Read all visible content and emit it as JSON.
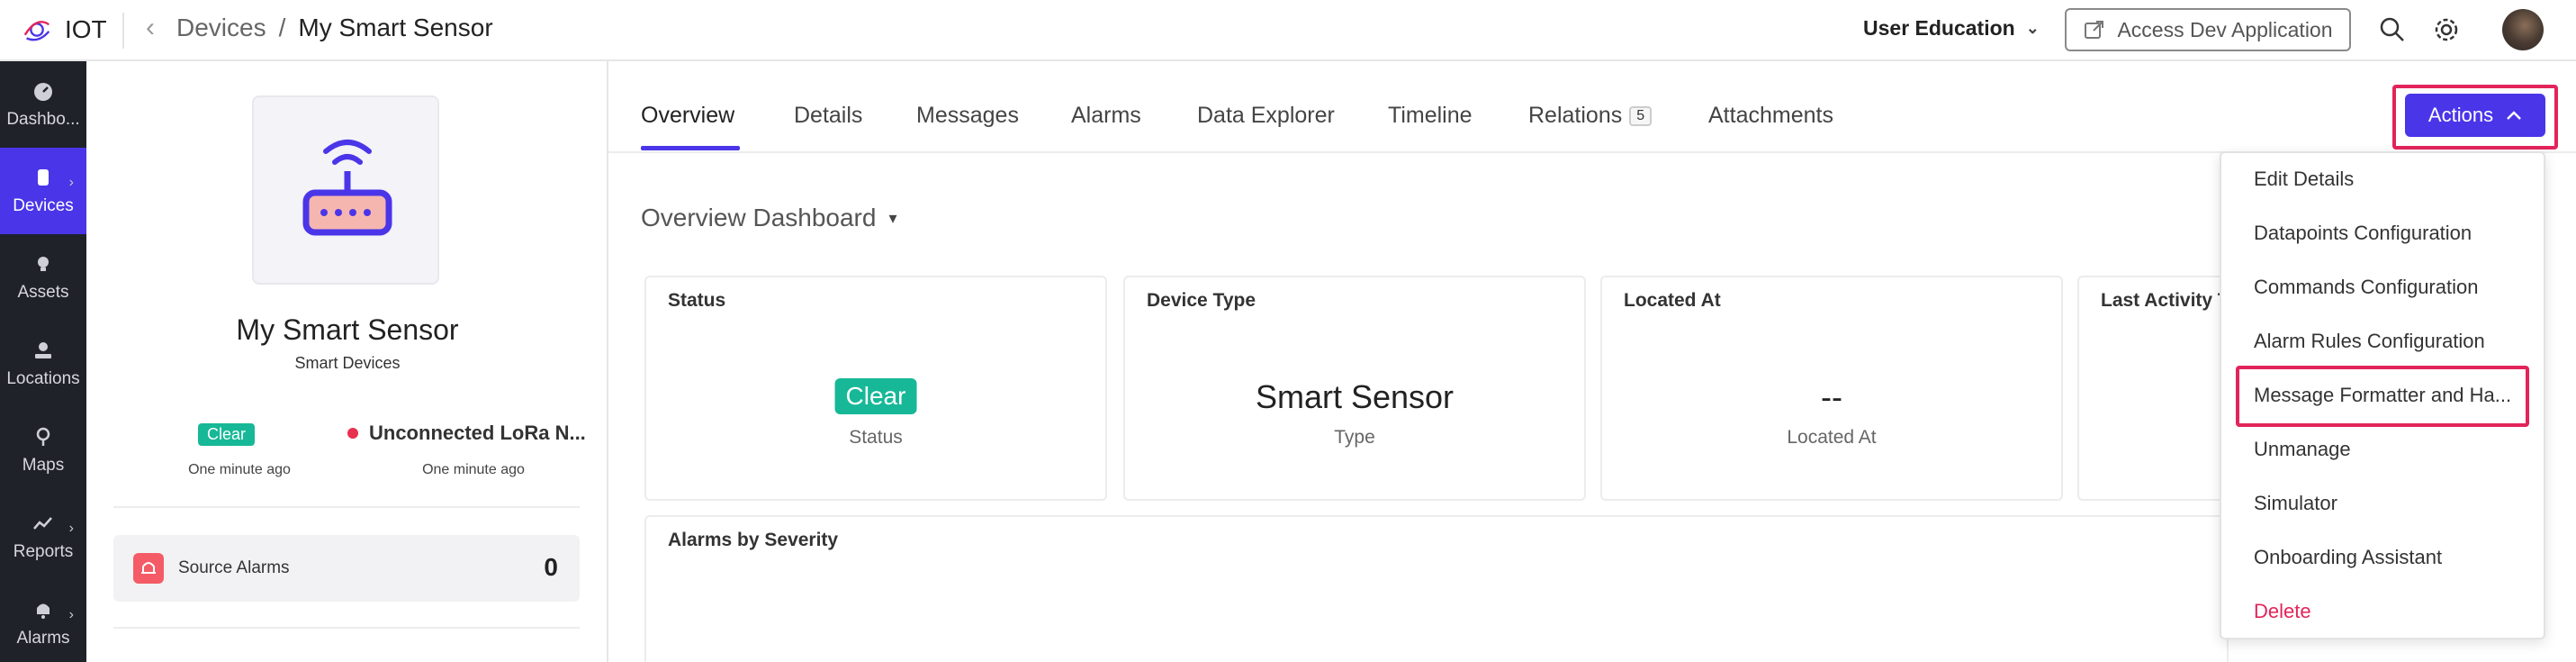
{
  "app": {
    "brand": "IOT"
  },
  "breadcrumb": {
    "parent": "Devices",
    "separator": "/",
    "current": "My Smart Sensor"
  },
  "header": {
    "org_name": "User Education",
    "dev_app_label": "Access Dev Application"
  },
  "nav": {
    "items": [
      {
        "label": "Dashbo..."
      },
      {
        "label": "Devices"
      },
      {
        "label": "Assets"
      },
      {
        "label": "Locations"
      },
      {
        "label": "Maps"
      },
      {
        "label": "Reports"
      },
      {
        "label": "Alarms"
      }
    ]
  },
  "device": {
    "name": "My Smart Sensor",
    "type": "Smart Devices",
    "status_badge": "Clear",
    "status_time": "One minute ago",
    "connection": "Unconnected LoRa N...",
    "connection_time": "One minute ago",
    "source_alarms_label": "Source Alarms",
    "source_alarms_count": "0"
  },
  "tabs": [
    {
      "label": "Overview"
    },
    {
      "label": "Details"
    },
    {
      "label": "Messages"
    },
    {
      "label": "Alarms"
    },
    {
      "label": "Data Explorer"
    },
    {
      "label": "Timeline"
    },
    {
      "label": "Relations",
      "count": "5"
    },
    {
      "label": "Attachments"
    }
  ],
  "actions": {
    "label": "Actions"
  },
  "dashboard": {
    "title": "Overview Dashboard",
    "cards": [
      {
        "title": "Status",
        "value": "Clear",
        "sub": "Status"
      },
      {
        "title": "Device Type",
        "value": "Smart Sensor",
        "sub": "Type"
      },
      {
        "title": "Located At",
        "value": "--",
        "sub": "Located At"
      },
      {
        "title": "Last Activity T"
      }
    ],
    "alarms_title": "Alarms by Severity"
  },
  "menu": {
    "items": [
      "Edit Details",
      "Datapoints Configuration",
      "Commands Configuration",
      "Alarm Rules Configuration",
      "Message Formatter and Ha...",
      "Unmanage",
      "Simulator",
      "Onboarding Assistant",
      "Delete"
    ]
  },
  "colors": {
    "accent": "#4a35e8",
    "success": "#17b897",
    "danger": "#e2245a",
    "nav_bg": "#1f2229"
  }
}
